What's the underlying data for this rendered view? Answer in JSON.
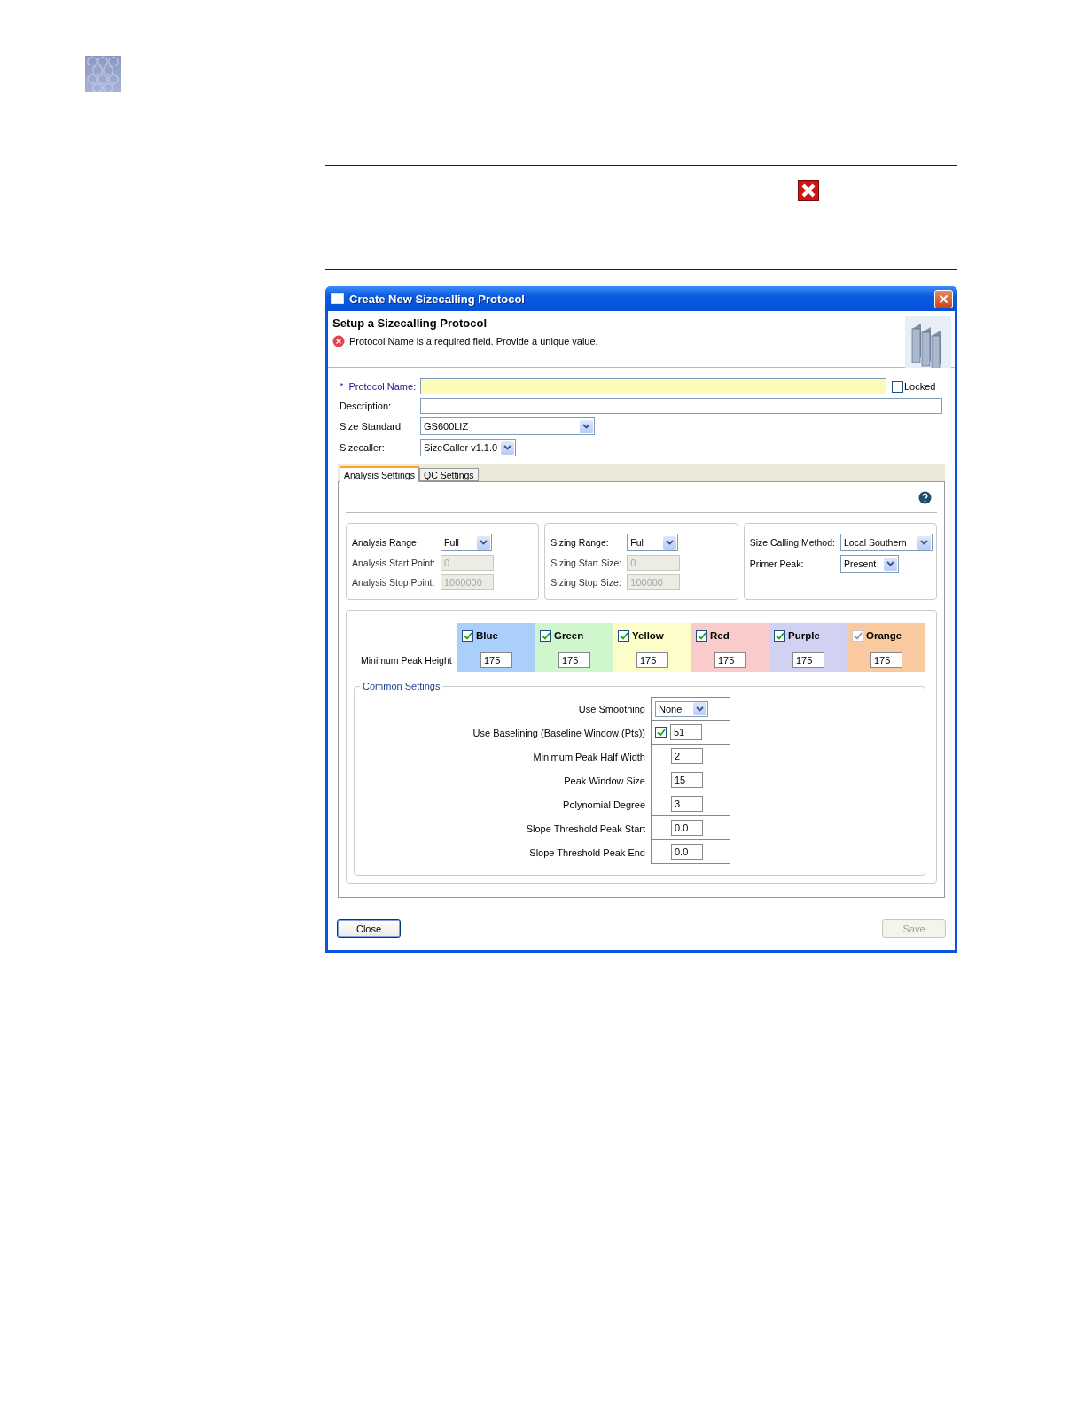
{
  "dialog": {
    "title": "Create New Sizecalling Protocol",
    "heading": "Setup a Sizecalling Protocol",
    "error": "Protocol Name is a required field. Provide a unique value.",
    "fields": [
      {
        "kind": "text",
        "label": "*  Protocol Name:",
        "required": true
      },
      {
        "kind": "text",
        "label": "Description:",
        "required": false
      },
      {
        "kind": "select",
        "label": "Size Standard:",
        "required": false,
        "value": "GS600LIZ"
      },
      {
        "kind": "select",
        "label": "Sizecaller:",
        "required": false,
        "value": "SizeCaller v1.1.0"
      }
    ],
    "locked": {
      "label": "Locked",
      "checked": false
    },
    "tabs": [
      {
        "label": "Analysis Settings",
        "selected": true
      },
      {
        "label": "QC Settings",
        "selected": false
      }
    ],
    "groups": [
      [
        {
          "label": "Analysis Range:",
          "kind": "select",
          "value": "Full"
        },
        {
          "label": "Analysis Start Point:",
          "kind": "text",
          "value": "0",
          "disabled": true
        },
        {
          "label": "Analysis Stop Point:",
          "kind": "text",
          "value": "1000000",
          "disabled": true
        }
      ],
      [
        {
          "label": "Sizing Range:",
          "kind": "select",
          "value": "Ful"
        },
        {
          "label": "Sizing Start Size:",
          "kind": "text",
          "value": "0",
          "disabled": true
        },
        {
          "label": "Sizing Stop Size:",
          "kind": "text",
          "value": "100000",
          "disabled": true
        }
      ],
      [
        {
          "label": "Size Calling Method:",
          "kind": "select",
          "value": "Local Southern"
        },
        {
          "label": "Primer Peak:",
          "kind": "select",
          "value": "Present"
        }
      ]
    ],
    "peak_row_label": "Minimum Peak Height",
    "dyes": [
      {
        "name": "Blue",
        "color": "#a9cffa",
        "checked": true,
        "disabled": false,
        "value": "175"
      },
      {
        "name": "Green",
        "color": "#cff6cc",
        "checked": true,
        "disabled": false,
        "value": "175"
      },
      {
        "name": "Yellow",
        "color": "#fdfdca",
        "checked": true,
        "disabled": false,
        "value": "175"
      },
      {
        "name": "Red",
        "color": "#f9cbcb",
        "checked": true,
        "disabled": false,
        "value": "175"
      },
      {
        "name": "Purple",
        "color": "#d1d1f2",
        "checked": true,
        "disabled": false,
        "value": "175"
      },
      {
        "name": "Orange",
        "color": "#f9caa0",
        "checked": true,
        "disabled": true,
        "value": "175"
      }
    ],
    "common": {
      "title": "Common Settings",
      "rows": [
        {
          "label": "Use Smoothing",
          "kind": "select",
          "value": "None"
        },
        {
          "label": "Use Baselining (Baseline Window (Pts))",
          "kind": "check-text",
          "checked": true,
          "value": "51"
        },
        {
          "label": "Minimum Peak Half Width",
          "kind": "text",
          "value": "2"
        },
        {
          "label": "Peak Window Size",
          "kind": "text",
          "value": "15"
        },
        {
          "label": "Polynomial Degree",
          "kind": "text",
          "value": "3"
        },
        {
          "label": "Slope Threshold Peak Start",
          "kind": "text",
          "value": "0.0"
        },
        {
          "label": "Slope Threshold Peak End",
          "kind": "text",
          "value": "0.0"
        }
      ]
    },
    "buttons": [
      {
        "label": "Close",
        "disabled": false
      },
      {
        "label": "Save",
        "disabled": true
      }
    ]
  }
}
